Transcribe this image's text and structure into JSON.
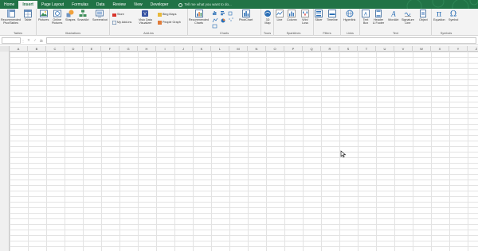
{
  "tabs": [
    "Home",
    "Insert",
    "Page Layout",
    "Formulas",
    "Data",
    "Review",
    "View",
    "Developer"
  ],
  "active_tab": "Insert",
  "tell_me": "Tell me what you want to do...",
  "ribbon": {
    "groups": [
      {
        "id": "tables",
        "label": "Tables",
        "commands": [
          {
            "icon": "pivottable-icon",
            "label": "Recommended\nPivotTables"
          },
          {
            "icon": "table-icon",
            "label": "Table"
          }
        ]
      },
      {
        "id": "illustrations",
        "label": "Illustrations",
        "commands": [
          {
            "icon": "pictures-icon",
            "label": "Pictures"
          },
          {
            "icon": "online-pictures-icon",
            "label": "Online\nPictures"
          },
          {
            "icon": "shapes-icon",
            "label": "Shapes"
          },
          {
            "icon": "smartart-icon",
            "label": "SmartArt"
          },
          {
            "icon": "screenshot-icon",
            "label": "Screenshot"
          }
        ]
      },
      {
        "id": "addins",
        "label": "Add-ins",
        "small_commands": [
          {
            "icon": "store-icon",
            "label": "Store"
          },
          {
            "icon": "my-addins-icon",
            "label": "My Add-ins"
          },
          {
            "icon": "visio-icon",
            "label": "Visio Data\nVisualizer"
          },
          {
            "icon": "bing-maps-icon",
            "label": "Bing Maps"
          },
          {
            "icon": "people-graph-icon",
            "label": "People Graph"
          }
        ]
      },
      {
        "id": "charts",
        "label": "Charts",
        "commands": [
          {
            "icon": "recommended-charts-icon",
            "label": "Recommended\nCharts"
          },
          {
            "icon": "pivotchart-icon",
            "label": "PivotChart"
          }
        ]
      },
      {
        "id": "tours",
        "label": "Tours",
        "commands": [
          {
            "icon": "3d-map-icon",
            "label": "3D\nMap"
          }
        ]
      },
      {
        "id": "sparklines",
        "label": "Sparklines",
        "commands": [
          {
            "icon": "line-sparkline-icon",
            "label": "Line"
          },
          {
            "icon": "column-sparkline-icon",
            "label": "Column"
          },
          {
            "icon": "winloss-sparkline-icon",
            "label": "Win/\nLoss"
          }
        ]
      },
      {
        "id": "filters",
        "label": "Filters",
        "commands": [
          {
            "icon": "slicer-icon",
            "label": "Slicer"
          },
          {
            "icon": "timeline-icon",
            "label": "Timeline"
          }
        ]
      },
      {
        "id": "links",
        "label": "Links",
        "commands": [
          {
            "icon": "hyperlink-icon",
            "label": "Hyperlink"
          }
        ]
      },
      {
        "id": "text",
        "label": "Text",
        "commands": [
          {
            "icon": "textbox-icon",
            "label": "Text\nBox"
          },
          {
            "icon": "header-footer-icon",
            "label": "Header\n& Footer"
          },
          {
            "icon": "wordart-icon",
            "label": "WordArt"
          },
          {
            "icon": "signature-line-icon",
            "label": "Signature\nLine"
          },
          {
            "icon": "object-icon",
            "label": "Object"
          }
        ]
      },
      {
        "id": "symbols",
        "label": "Symbols",
        "commands": [
          {
            "icon": "equation-icon",
            "label": "Equation"
          },
          {
            "icon": "symbol-icon",
            "label": "Symbol"
          }
        ]
      }
    ]
  },
  "formula_bar": {
    "name_box": "",
    "fx": "fx",
    "cancel": "✕",
    "enter": "✓",
    "separator": "⋮",
    "value": ""
  },
  "columns": [
    "A",
    "B",
    "C",
    "D",
    "E",
    "F",
    "G",
    "H",
    "I",
    "J",
    "K",
    "L",
    "M",
    "N",
    "O",
    "P",
    "Q",
    "R",
    "S",
    "T",
    "U",
    "V",
    "W",
    "X",
    "Y",
    "Z",
    "AA"
  ],
  "colors": {
    "accent": "#217346",
    "ribbon_bg": "#f3f3f3",
    "grid_line": "#e3e3e3"
  }
}
